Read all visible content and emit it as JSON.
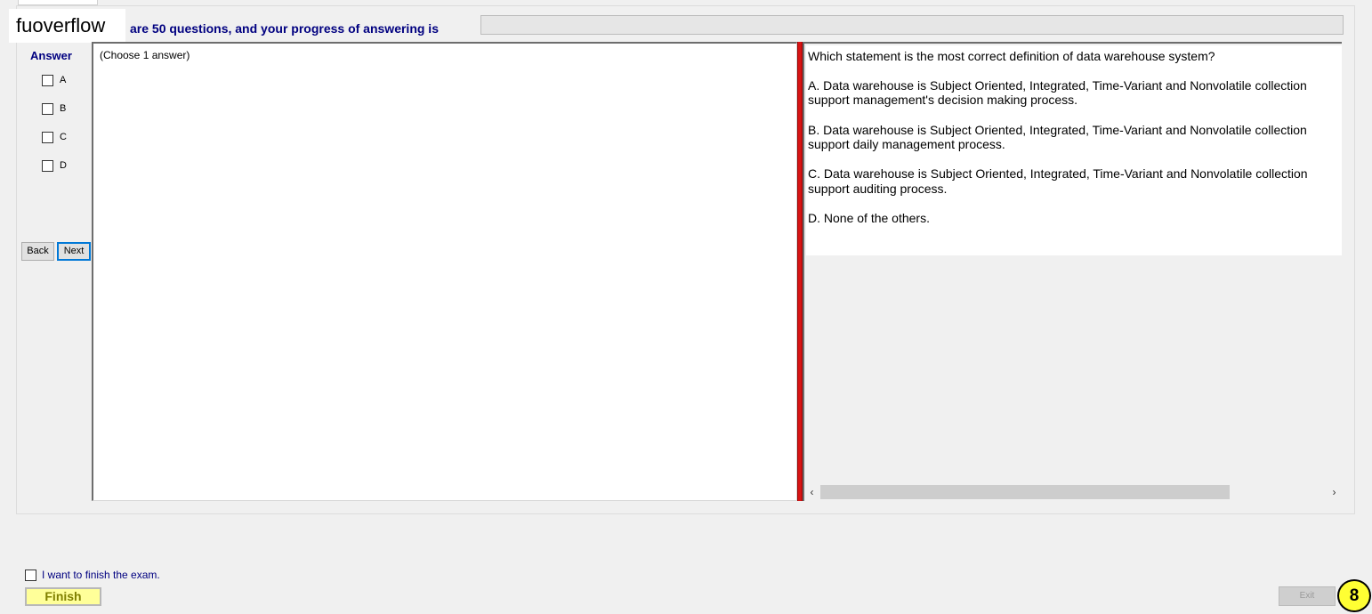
{
  "watermark": "fuoverflow",
  "header": {
    "progress_text": "are 50 questions, and your progress of answering is",
    "progress_fraction": 0
  },
  "answer_panel": {
    "heading": "Answer",
    "options": [
      "A",
      "B",
      "C",
      "D"
    ],
    "back_label": "Back",
    "next_label": "Next"
  },
  "left_pane": {
    "instruction": "(Choose 1 answer)"
  },
  "question": {
    "lines": [
      "Which statement is the most correct definition of data warehouse system?",
      "A.  Data warehouse is Subject Oriented, Integrated, Time-Variant and Nonvolatile collection",
      "support management's decision making process.",
      "B.  Data warehouse is Subject Oriented, Integrated, Time-Variant and Nonvolatile collection",
      "support daily management process.",
      "C.  Data warehouse is Subject Oriented, Integrated, Time-Variant and Nonvolatile collection",
      "support auditing process.",
      "D.  None of the others."
    ]
  },
  "scrollbar": {
    "left_arrow": "‹",
    "right_arrow": "›"
  },
  "footer": {
    "finish_checkbox_label": "I want to finish the exam.",
    "finish_label": "Finish",
    "exit_label": "Exit",
    "badge_number": "8"
  },
  "colors": {
    "accent_text": "#000080",
    "divider_red": "#d71414",
    "finish_bg": "#ffff99",
    "badge_bg": "#ffff33"
  }
}
